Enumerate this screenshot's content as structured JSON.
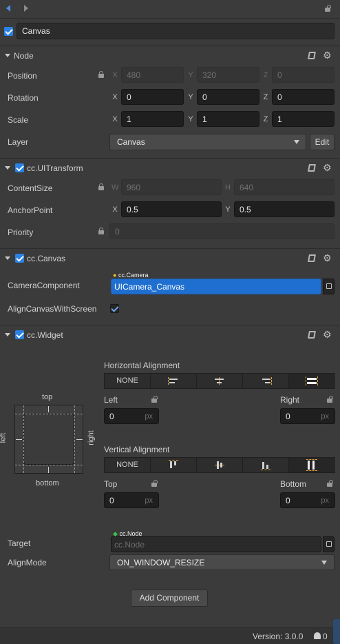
{
  "node": {
    "name": "Canvas",
    "active": true
  },
  "node_section": {
    "title": "Node",
    "position": {
      "label": "Position",
      "x": "480",
      "y": "320",
      "z": "0"
    },
    "rotation": {
      "label": "Rotation",
      "x": "0",
      "y": "0",
      "z": "0"
    },
    "scale": {
      "label": "Scale",
      "x": "1",
      "y": "1",
      "z": "1"
    },
    "layer": {
      "label": "Layer",
      "value": "Canvas",
      "edit": "Edit"
    }
  },
  "axes": {
    "x": "X",
    "y": "Y",
    "z": "Z",
    "w": "W",
    "h": "H"
  },
  "ui_transform": {
    "title": "cc.UITransform",
    "content_size": {
      "label": "ContentSize",
      "w": "960",
      "h": "640"
    },
    "anchor_point": {
      "label": "AnchorPoint",
      "x": "0.5",
      "y": "0.5"
    },
    "priority": {
      "label": "Priority",
      "value": "0"
    }
  },
  "canvas": {
    "title": "cc.Canvas",
    "camera_component": {
      "label": "CameraComponent",
      "type_tag": "cc.Camera",
      "value": "UICamera_Canvas"
    },
    "align_canvas": {
      "label": "AlignCanvasWithScreen",
      "checked": true
    }
  },
  "widget": {
    "title": "cc.Widget",
    "horizontal_alignment": "Horizontal Alignment",
    "vertical_alignment": "Vertical Alignment",
    "none_label": "NONE",
    "left": {
      "label": "Left",
      "value": "0",
      "unit": "px"
    },
    "right": {
      "label": "Right",
      "value": "0",
      "unit": "px"
    },
    "top": {
      "label": "Top",
      "value": "0",
      "unit": "px"
    },
    "bottom": {
      "label": "Bottom",
      "value": "0",
      "unit": "px"
    },
    "diagram": {
      "top": "top",
      "bottom": "bottom",
      "left": "left",
      "right": "right"
    },
    "target": {
      "label": "Target",
      "type_tag": "cc.Node",
      "placeholder": "cc.Node"
    },
    "align_mode": {
      "label": "AlignMode",
      "value": "ON_WINDOW_RESIZE"
    }
  },
  "add_component": "Add Component",
  "footer": {
    "version": "Version: 3.0.0",
    "notifications": "0"
  },
  "colors": {
    "accent": "#2a82e4",
    "selection": "#1f6fd0",
    "panel": "#3b3b3b",
    "input": "#1f1f1f"
  }
}
